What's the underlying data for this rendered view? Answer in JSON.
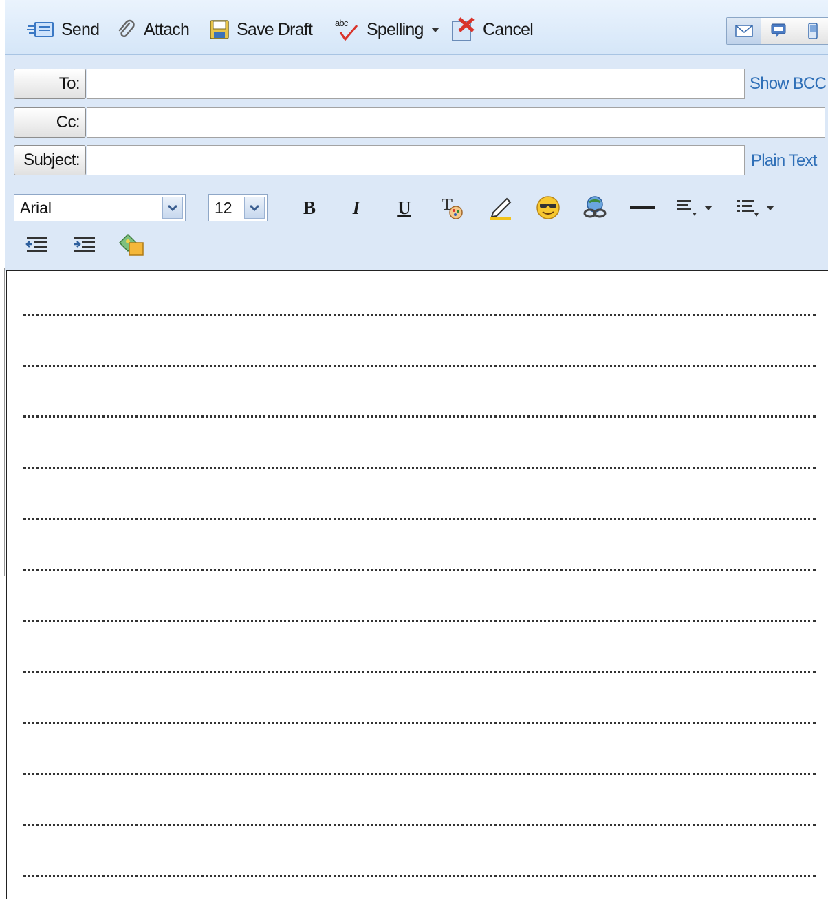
{
  "toolbar": {
    "send_label": "Send",
    "attach_label": "Attach",
    "save_draft_label": "Save Draft",
    "spelling_label": "Spelling",
    "cancel_label": "Cancel"
  },
  "view_modes": [
    "email-icon",
    "instant-message-icon",
    "mobile-text-icon"
  ],
  "fields": {
    "to_label": "To:",
    "to_value": "",
    "cc_label": "Cc:",
    "cc_value": "",
    "subject_label": "Subject:",
    "subject_value": "",
    "show_bcc_label": "Show BCC",
    "plain_text_label": "Plain Text"
  },
  "formatting": {
    "font_family": "Arial",
    "font_size": "12",
    "bold_label": "B",
    "italic_label": "I",
    "underline_label": "U"
  },
  "colors": {
    "toolbar_bg": "#dce8f7",
    "link": "#2f6fb7",
    "highlight": "#f2c21b"
  },
  "editor": {
    "body_text": "",
    "ruled_line_count": 12
  }
}
